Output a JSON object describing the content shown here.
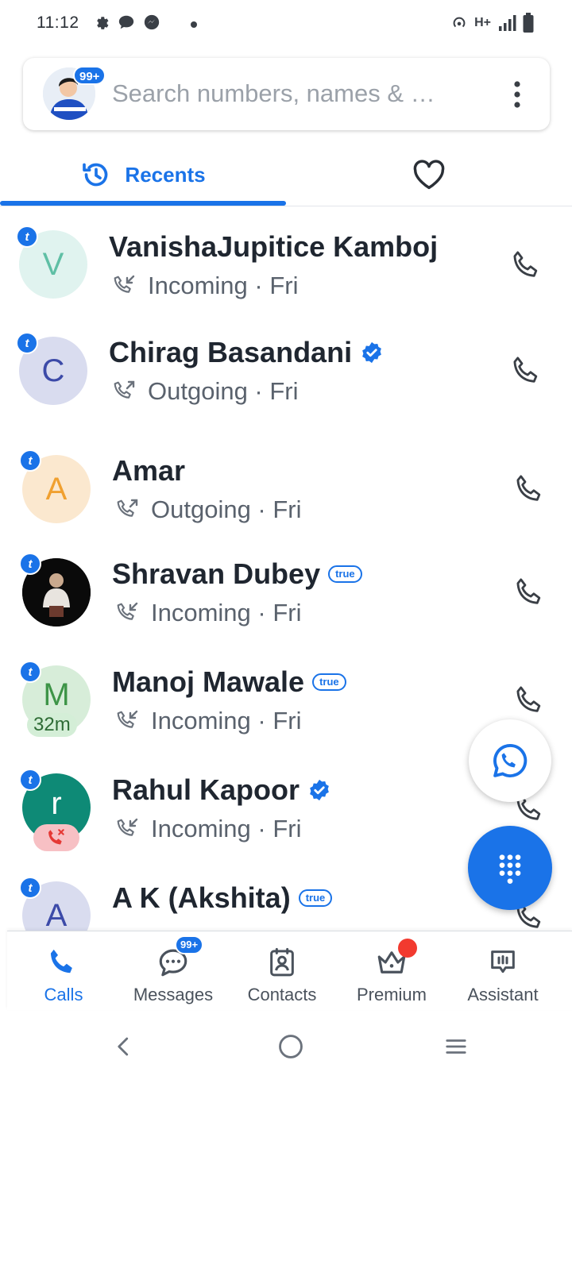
{
  "status_bar": {
    "time": "11:12",
    "left_icons": [
      "settings-icon",
      "chat-bubble-icon",
      "messenger-icon"
    ],
    "network": "H+",
    "right_icons": [
      "hotspot-icon",
      "signal-icon",
      "battery-icon"
    ]
  },
  "search": {
    "placeholder": "Search numbers, names & …",
    "profile_badge": "99+"
  },
  "tabs": [
    {
      "label": "Recents",
      "icon": "history-icon",
      "active": true
    },
    {
      "label": "",
      "icon": "heart-icon",
      "active": false
    }
  ],
  "calls": [
    {
      "name": "VanishaJupitice Kamboj",
      "initial": "V",
      "avatar_bg": "#e0f3ef",
      "avatar_fg": "#5fbfa5",
      "status": "Incoming · Fri",
      "direction": "incoming",
      "verified": false,
      "true_badge": false
    },
    {
      "name": "Chirag Basandani",
      "initial": "C",
      "avatar_bg": "#d9dcef",
      "avatar_fg": "#3c4aa8",
      "status": "Outgoing · Fri",
      "direction": "outgoing",
      "verified": true,
      "true_badge": false
    },
    {
      "name": "Amar",
      "initial": "A",
      "avatar_bg": "#fbe8cf",
      "avatar_fg": "#f0a030",
      "status": "Outgoing · Fri",
      "direction": "outgoing",
      "verified": false,
      "true_badge": false
    },
    {
      "name": "Shravan Dubey",
      "initial": "",
      "avatar_bg": "#0a0a0a",
      "avatar_fg": "#ffffff",
      "status": "Incoming · Fri",
      "direction": "incoming",
      "verified": false,
      "true_badge": true
    },
    {
      "name": "Manoj Mawale",
      "initial": "M",
      "avatar_bg": "#d7edd9",
      "avatar_fg": "#3d9447",
      "status": "Incoming · Fri",
      "direction": "incoming",
      "verified": false,
      "true_badge": true,
      "time_chip": "32m"
    },
    {
      "name": "Rahul Kapoor",
      "initial": "r",
      "avatar_bg": "#0e8a76",
      "avatar_fg": "#ffffff",
      "status": "Incoming · Fri",
      "direction": "incoming",
      "verified": true,
      "true_badge": false
    },
    {
      "name": "A K (Akshita)",
      "initial": "A",
      "avatar_bg": "#d9dcef",
      "avatar_fg": "#3c4aa8",
      "status": "",
      "direction": "",
      "verified": false,
      "true_badge": true
    }
  ],
  "true_label": "true",
  "t_badge": "t",
  "bottom_nav": [
    {
      "label": "Calls",
      "icon": "phone-icon",
      "active": true
    },
    {
      "label": "Messages",
      "icon": "message-icon",
      "badge": "99+"
    },
    {
      "label": "Contacts",
      "icon": "contacts-icon"
    },
    {
      "label": "Premium",
      "icon": "crown-icon",
      "dot": true
    },
    {
      "label": "Assistant",
      "icon": "assistant-icon"
    }
  ],
  "colors": {
    "accent": "#1a73e8",
    "missed": "#f23a2f"
  }
}
